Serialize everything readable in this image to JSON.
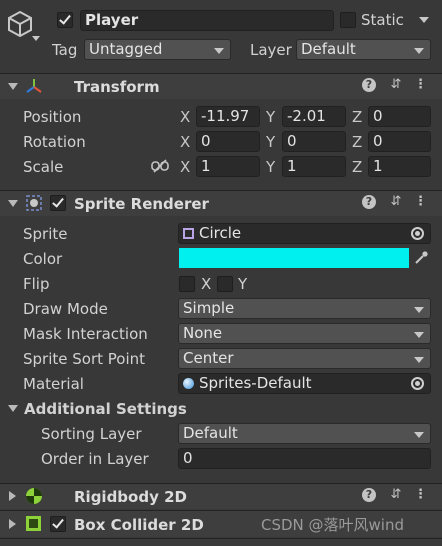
{
  "header": {
    "name": "Player",
    "static_label": "Static",
    "tag_label": "Tag",
    "tag_value": "Untagged",
    "layer_label": "Layer",
    "layer_value": "Default",
    "active": true,
    "static": false
  },
  "transform": {
    "title": "Transform",
    "position": {
      "label": "Position",
      "x": "-11.97",
      "y": "-2.01",
      "z": "0"
    },
    "rotation": {
      "label": "Rotation",
      "x": "0",
      "y": "0",
      "z": "0"
    },
    "scale": {
      "label": "Scale",
      "x": "1",
      "y": "1",
      "z": "1"
    },
    "axis_x": "X",
    "axis_y": "Y",
    "axis_z": "Z"
  },
  "sprite_renderer": {
    "title": "Sprite Renderer",
    "enabled": true,
    "sprite_label": "Sprite",
    "sprite_value": "Circle",
    "color_label": "Color",
    "color_value": "#00f0f0",
    "flip_label": "Flip",
    "flip_x": "X",
    "flip_y": "Y",
    "draw_mode_label": "Draw Mode",
    "draw_mode_value": "Simple",
    "mask_label": "Mask Interaction",
    "mask_value": "None",
    "sort_point_label": "Sprite Sort Point",
    "sort_point_value": "Center",
    "material_label": "Material",
    "material_value": "Sprites-Default",
    "additional_settings": "Additional Settings",
    "sorting_layer_label": "Sorting Layer",
    "sorting_layer_value": "Default",
    "order_label": "Order in Layer",
    "order_value": "0"
  },
  "rigidbody": {
    "title": "Rigidbody 2D"
  },
  "box_collider": {
    "title": "Box Collider 2D",
    "enabled": true
  },
  "watermark": "CSDN @落叶风wind"
}
